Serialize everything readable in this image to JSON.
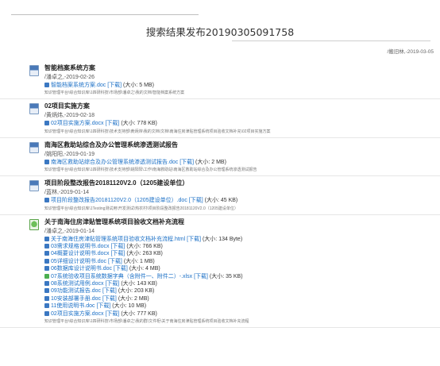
{
  "header": {
    "title": "搜索结果发布20190305091758",
    "meta": "/搬旧林,-2019-03-05"
  },
  "results": [
    {
      "title": "智能档案系统方案",
      "author": "/潘卓之,-2019-02-26",
      "files": [
        {
          "name": "智能档案系统方案.doc",
          "download": "[下载]",
          "size": "(大小: 5 MB)"
        }
      ],
      "path": "知识管理平台\\综合知识库\\1四研科技\\市场部\\潘卓之\\我的文档\\智能档案系统方案"
    },
    {
      "title": "02项目实施方案",
      "author": "/黄炳炜,-2019-02-18",
      "files": [
        {
          "name": "02项目实施方案.docx",
          "download": "[下载]",
          "size": "(大小: 778 KB)"
        }
      ],
      "path": "知识管理平台\\综合知识库\\1四研科技\\技术支持部\\黄炳炜\\我的文档\\文档\\南海住房津贴管理系统项目验收文档补充\\02项目实施方案"
    },
    {
      "title": "南海区救助站综合及办公管理系统渗透测试报告",
      "author": "/姚阳阳,-2019-01-19",
      "files": [
        {
          "name": "南海区救助站综合及办公管理系统渗透测试报告.doc",
          "download": "[下载]",
          "size": "(大小: 2 MB)"
        }
      ],
      "path": "知识管理平台\\综合知识库\\1四研科技\\技术支持部\\姚阳阳\\工作\\南海救助站\\南海区救助站综合及办公管理系统渗透测试报告"
    },
    {
      "title": "项目阶段整改报告20181120V2.0（1205建设单位）",
      "author": "/蓝林,-2019-01-14",
      "files": [
        {
          "name": "项目阶段整改报告20181120V2.0（1205建设单位）.doc",
          "download": "[下载]",
          "size": "(大小: 45 KB)"
        }
      ],
      "path": "知识管理平台\\综合知识库\\1Testing测试用\\开发测试\\热农村\\项目阶段整改报告20181120V2.0（1205建设单位）"
    },
    {
      "title": "关于南海住房津贴管理系统项目验收文档补充流程",
      "author": "/潘卓之,-2019-01-14",
      "files": [
        {
          "name": "关于南海住房津贴管理系统项目验收文档补充流程.html",
          "download": "[下载]",
          "size": "(大小: 134 Byte)"
        },
        {
          "name": "03需求规格说明书.docx",
          "download": "[下载]",
          "size": "(大小: 766 KB)"
        },
        {
          "name": "04概要设计说明书.docx",
          "download": "[下载]",
          "size": "(大小: 263 KB)"
        },
        {
          "name": "05详细设计说明书.doc",
          "download": "[下载]",
          "size": "(大小: 1 MB)"
        },
        {
          "name": "06数据库设计说明书.doc",
          "download": "[下载]",
          "size": "(大小: 4 MB)"
        },
        {
          "name": "07系统验收项目系统数据字典（含附件一、附件二）-.xlsx",
          "download": "[下载]",
          "size": "(大小: 35 KB)"
        },
        {
          "name": "08系统测试用例.docx",
          "download": "[下载]",
          "size": "(大小: 143 KB)"
        },
        {
          "name": "09功能测试报告.doc",
          "download": "[下载]",
          "size": "(大小: 203 KB)"
        },
        {
          "name": "10安装部署手册.doc",
          "download": "[下载]",
          "size": "(大小: 2 MB)"
        },
        {
          "name": "11使用说明书.doc",
          "download": "[下载]",
          "size": "(大小: 10 MB)"
        },
        {
          "name": "02项目实施方案.docx",
          "download": "[下载]",
          "size": "(大小: 777 KB)"
        }
      ],
      "path": "知识管理平台\\综合知识库\\1四研科技\\市场部\\潘卓之\\我的群\\文件柜\\关于南海住房津贴管理系统项目验收文档补充流程"
    }
  ]
}
